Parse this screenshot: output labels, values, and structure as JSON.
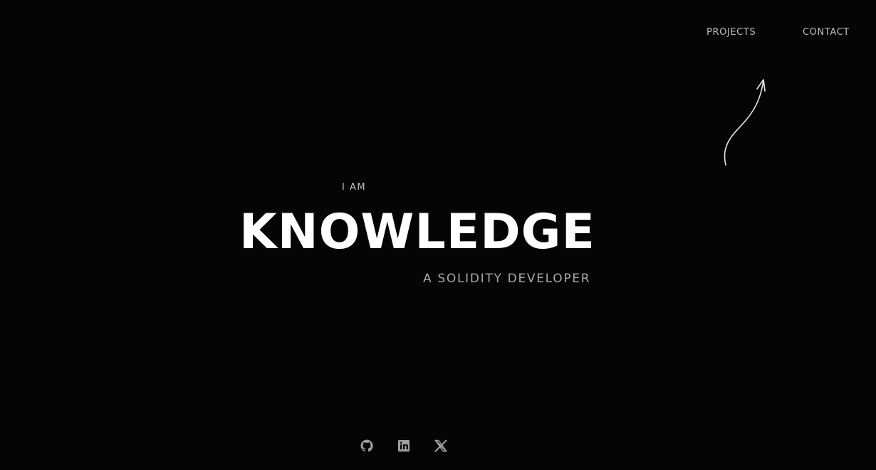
{
  "nav": {
    "items": [
      {
        "label": "PROJECTS"
      },
      {
        "label": "CONTACT"
      }
    ]
  },
  "hero": {
    "intro": "I AM",
    "name": "KNOWLEDGE",
    "role": "A SOLIDITY DEVELOPER"
  },
  "social": [
    {
      "icon": "github-icon"
    },
    {
      "icon": "linkedin-icon"
    },
    {
      "icon": "x-icon"
    }
  ],
  "colors": {
    "background": "#050505",
    "headline": "#ffffff",
    "muted_text": "#a9a9a9",
    "nav_text": "#bdbdbd",
    "icon": "#a0a0a0"
  }
}
